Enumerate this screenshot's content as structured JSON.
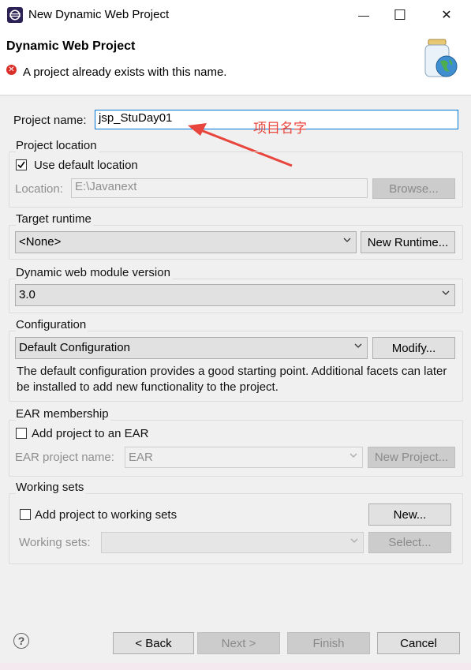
{
  "window": {
    "title": "New Dynamic Web Project",
    "minimize": "—",
    "maximize": "☐",
    "close": "✕"
  },
  "header": {
    "title": "Dynamic Web Project",
    "error_message": "A project already exists with this name."
  },
  "project_name": {
    "label": "Project name:",
    "value": "jsp_StuDay01",
    "annotation": "项目名字"
  },
  "project_location": {
    "group_label": "Project location",
    "use_default_label": "Use default location",
    "use_default_checked": true,
    "location_label": "Location:",
    "location_value": "E:\\Javanext",
    "browse_label": "Browse..."
  },
  "target_runtime": {
    "group_label": "Target runtime",
    "selected": "<None>",
    "new_runtime_label": "New Runtime..."
  },
  "module_version": {
    "group_label": "Dynamic web module version",
    "selected": "3.0"
  },
  "configuration": {
    "group_label": "Configuration",
    "selected": "Default Configuration",
    "modify_label": "Modify...",
    "description": "The default configuration provides a good starting point. Additional facets can later be installed to add new functionality to the project."
  },
  "ear": {
    "group_label": "EAR membership",
    "add_label": "Add project to an EAR",
    "add_checked": false,
    "name_label": "EAR project name:",
    "name_value": "EAR",
    "new_project_label": "New Project..."
  },
  "working_sets": {
    "group_label": "Working sets",
    "add_label": "Add project to working sets",
    "add_checked": false,
    "new_label": "New...",
    "sets_label": "Working sets:",
    "sets_value": "",
    "select_label": "Select..."
  },
  "footer": {
    "help": "?",
    "back_label": "< Back",
    "next_label": "Next >",
    "finish_label": "Finish",
    "cancel_label": "Cancel"
  }
}
